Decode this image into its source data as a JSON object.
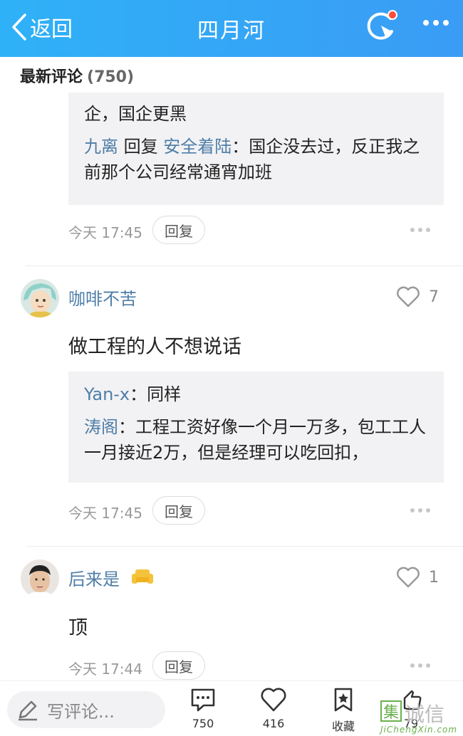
{
  "header": {
    "back_label": "返回",
    "title": "四月河"
  },
  "section": {
    "title": "最新评论",
    "count": "(750)"
  },
  "comments": [
    {
      "replies": [
        {
          "text": "企，国企更黑"
        },
        {
          "user": "九离",
          "verb": "回复",
          "target": "安全着陆",
          "sep": "：",
          "text": "国企没去过，反正我之前那个公司经常通宵加班"
        }
      ],
      "time": "今天 17:45",
      "reply_label": "回复"
    },
    {
      "username": "咖啡不苦",
      "likes": "7",
      "text": "做工程的人不想说话",
      "replies": [
        {
          "user": "Yan-x",
          "sep": "：",
          "text": "同样"
        },
        {
          "user": "涛阁",
          "sep": "：",
          "text": "工程工资好像一个月一万多，包工工人一月接近2万，但是经理可以吃回扣，"
        }
      ],
      "time": "今天 17:45",
      "reply_label": "回复"
    },
    {
      "username": "后来是",
      "likes": "1",
      "text": "顶",
      "time": "今天 17:44",
      "reply_label": "回复"
    }
  ],
  "bottom_bar": {
    "write_placeholder": "写评论...",
    "comments_count": "750",
    "likes_count": "416",
    "favorite_label": "收藏",
    "share_count": "79"
  },
  "watermark": {
    "box_char": "集",
    "text": "诚信",
    "sub": "JiChengXin.com"
  },
  "colors": {
    "header_bg": "#2fb1f7",
    "username": "#4f7ea8",
    "notification_dot": "#ff4d3c"
  }
}
